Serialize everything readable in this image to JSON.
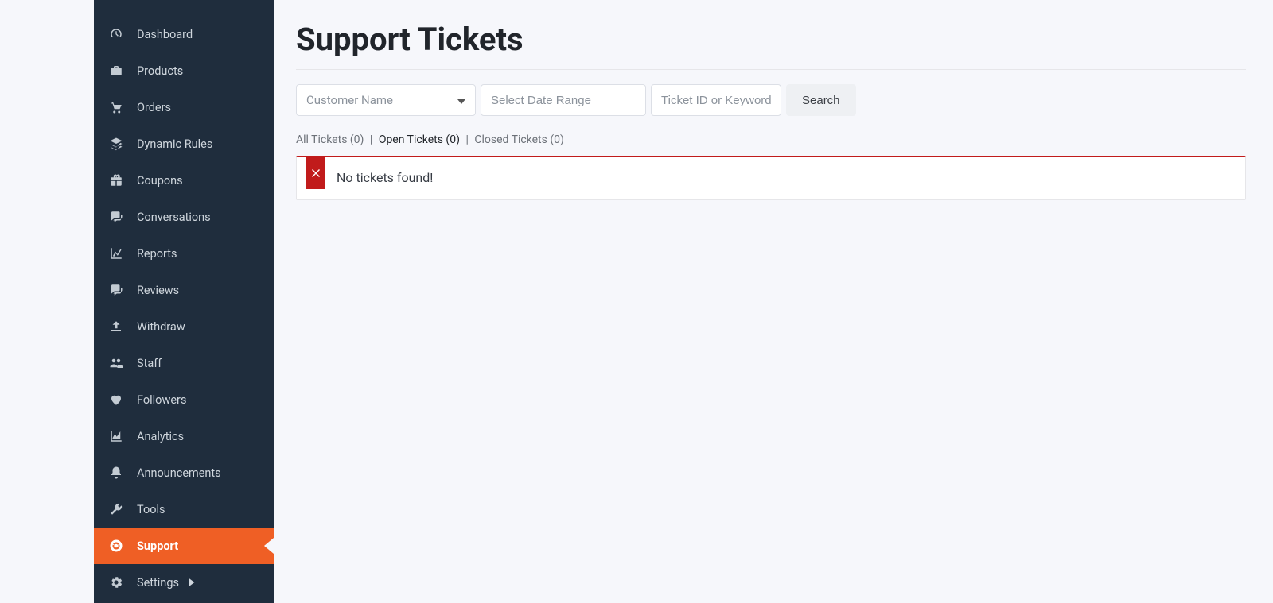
{
  "sidebar": {
    "items": [
      {
        "label": "Dashboard"
      },
      {
        "label": "Products"
      },
      {
        "label": "Orders"
      },
      {
        "label": "Dynamic Rules"
      },
      {
        "label": "Coupons"
      },
      {
        "label": "Conversations"
      },
      {
        "label": "Reports"
      },
      {
        "label": "Reviews"
      },
      {
        "label": "Withdraw"
      },
      {
        "label": "Staff"
      },
      {
        "label": "Followers"
      },
      {
        "label": "Analytics"
      },
      {
        "label": "Announcements"
      },
      {
        "label": "Tools"
      },
      {
        "label": "Support"
      },
      {
        "label": "Settings"
      }
    ]
  },
  "page": {
    "title": "Support Tickets"
  },
  "filters": {
    "customer_label": "Customer Name",
    "date_placeholder": "Select Date Range",
    "keyword_placeholder": "Ticket ID or Keyword",
    "search_label": "Search"
  },
  "tabs": {
    "all": "All Tickets (0)",
    "open": "Open Tickets (0)",
    "closed": "Closed Tickets (0)",
    "sep": "|"
  },
  "alert": {
    "text": "No tickets found!"
  }
}
